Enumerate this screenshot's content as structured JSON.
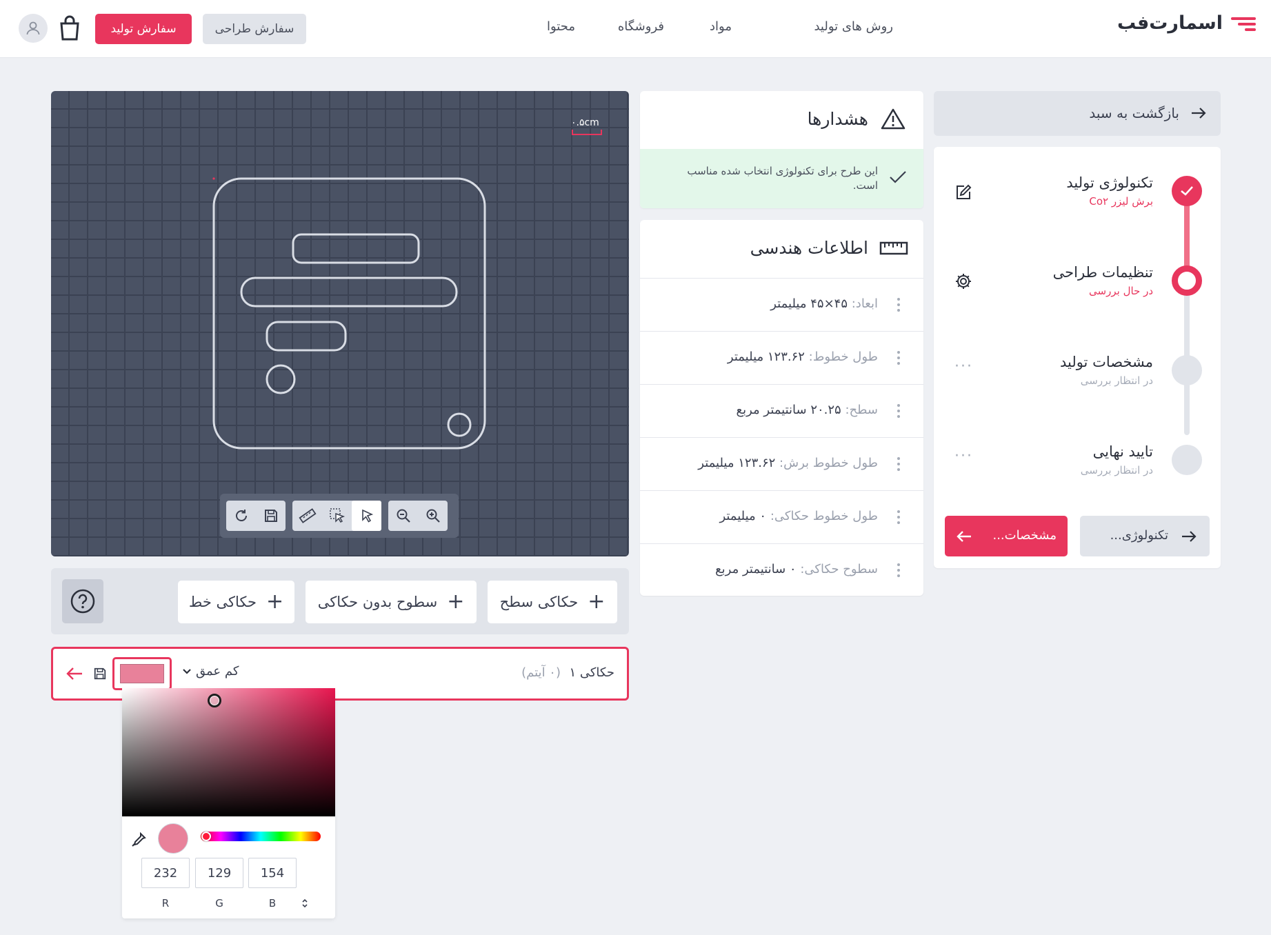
{
  "header": {
    "logo_text": "اسمارت‌فب",
    "nav": [
      "روش های تولید",
      "مواد",
      "فروشگاه",
      "محتوا"
    ],
    "design_order": "سفارش طراحی",
    "production_order": "سفارش تولید"
  },
  "canvas": {
    "scale_label": "۰.۵cm",
    "tools": [
      "refresh-icon",
      "save-icon",
      "ruler-icon",
      "multi-select-icon",
      "pointer-icon",
      "zoom-out-icon",
      "zoom-in-icon"
    ]
  },
  "actions": {
    "surface_engrave": "حکاکی سطح",
    "surfaces_no_engrave": "سطوح بدون حکاکی",
    "line_engrave": "حکاکی خط"
  },
  "engraving": {
    "name": "حکاکی ۱",
    "count": "(۰ آیتم)",
    "depth": "کم عمق",
    "swatch_color": "#e8819a"
  },
  "picker": {
    "r": "232",
    "g": "129",
    "b": "154",
    "r_label": "R",
    "g_label": "G",
    "b_label": "B"
  },
  "warnings": {
    "title": "هشدارها",
    "message": "این طرح برای تکنولوژی انتخاب شده مناسب است."
  },
  "geometry": {
    "title": "اطلاعات هندسی",
    "rows": [
      {
        "key": "ابعاد:",
        "value": "۴۵×۴۵ میلیمتر"
      },
      {
        "key": "طول خطوط:",
        "value": "۱۲۳.۶۲ میلیمتر"
      },
      {
        "key": "سطح:",
        "value": "۲۰.۲۵ سانتیمتر مربع"
      },
      {
        "key": "طول خطوط برش:",
        "value": "۱۲۳.۶۲ میلیمتر"
      },
      {
        "key": "طول خطوط حکاکی:",
        "value": "۰ میلیمتر"
      },
      {
        "key": "سطوح حکاکی:",
        "value": "۰ سانتیمتر مربع"
      }
    ]
  },
  "steps": {
    "back_to_cart": "بازگشت به سبد",
    "items": [
      {
        "title": "تکنولوژی تولید",
        "sub": "برش لیزر Co۲"
      },
      {
        "title": "تنظیمات طراحی",
        "sub": "در حال بررسی"
      },
      {
        "title": "مشخصات تولید",
        "sub": "در انتظار بررسی"
      },
      {
        "title": "تایید نهایی",
        "sub": "در انتظار بررسی"
      }
    ],
    "prev_label": "تکنولوژی...",
    "next_label": "مشخصات..."
  },
  "colors": {
    "accent": "#e8365d",
    "success_bg": "#e3f7ea",
    "canvas_bg": "#4a5264"
  }
}
